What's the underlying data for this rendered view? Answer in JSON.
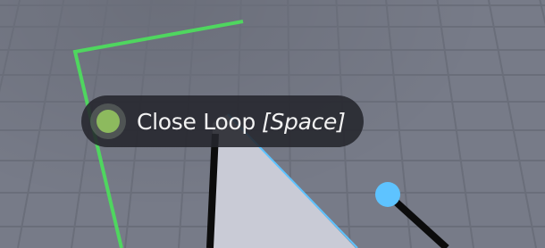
{
  "viewport": {
    "background_color": "#777b88",
    "grid_line_color": "#6a6e7a"
  },
  "selection_outline": {
    "color": "#4fd65f"
  },
  "polygon_fill": {
    "fill_color": "#c9cbd6",
    "edge_color": "#5ec3ff"
  },
  "vertex_handle": {
    "color": "#5ec3ff",
    "icon": "vertex-handle-icon"
  },
  "stroke_lines": {
    "color": "#0c0c0c"
  },
  "tooltip": {
    "label": "Close Loop",
    "shortcut": "[Space]",
    "indicator_color": "#8dba5e",
    "icon": "status-dot-icon"
  }
}
